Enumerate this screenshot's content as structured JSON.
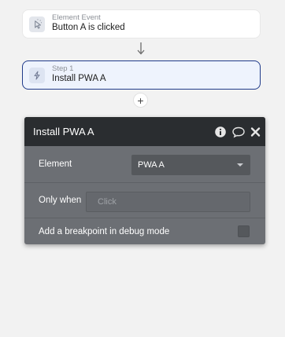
{
  "event_card": {
    "subtitle": "Element Event",
    "title": "Button A is clicked",
    "icon": "pointer-click-icon"
  },
  "step_card": {
    "subtitle": "Step 1",
    "title": "Install PWA A",
    "icon": "lightning-bolt-icon",
    "border_color": "#1f3a8a"
  },
  "add_step": {
    "label": "+"
  },
  "panel": {
    "title": "Install PWA A",
    "header_icons": [
      "info-icon",
      "comment-icon",
      "close-icon"
    ],
    "rows": {
      "element": {
        "label": "Element",
        "value": "PWA A"
      },
      "only_when": {
        "label": "Only when",
        "placeholder": "Click"
      },
      "debug": {
        "label": "Add a breakpoint in debug mode",
        "checked": false
      }
    }
  }
}
